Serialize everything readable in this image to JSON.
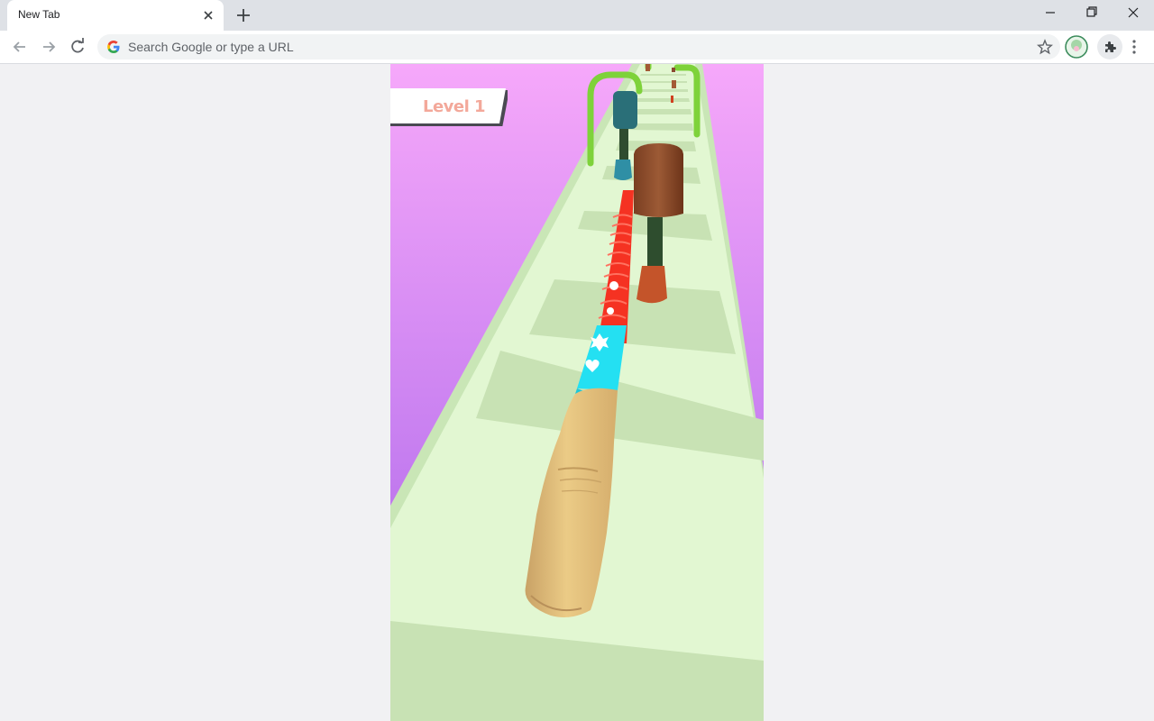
{
  "browser": {
    "tab_title": "New Tab",
    "omnibox_placeholder": "Search Google or type a URL"
  },
  "game": {
    "level_label": "Level 1"
  },
  "colors": {
    "sky_top": "#f4a6f8",
    "sky_bottom": "#b66ee4",
    "track_light": "#e2f7d2",
    "track_dark": "#c6e0b2",
    "finger": "#e6c280",
    "ring_red": "#f2281f",
    "ring_cyan": "#25e6f4"
  }
}
